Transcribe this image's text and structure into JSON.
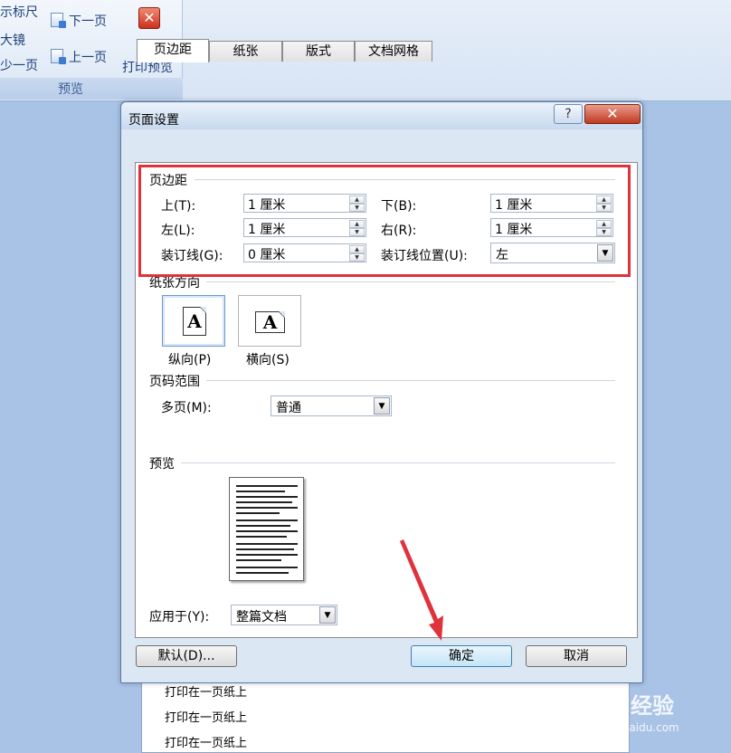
{
  "ribbon": {
    "items": [
      "示标尺",
      "大镜",
      "少一页"
    ],
    "next_page": "下一页",
    "prev_page": "上一页",
    "close_line1": "关闭",
    "close_line2": "打印预览",
    "group_label": "预览"
  },
  "background_page": {
    "lines": [
      "打印在一页纸上",
      "打印在一页纸上",
      "打印在一页纸上"
    ]
  },
  "dialog": {
    "title": "页面设置",
    "help_label": "?",
    "close_label": "✕",
    "tabs": [
      "页边距",
      "纸张",
      "版式",
      "文档网格"
    ],
    "margins": {
      "section_label": "页边距",
      "top_label": "上(T):",
      "top_value": "1 厘米",
      "bottom_label": "下(B):",
      "bottom_value": "1 厘米",
      "left_label": "左(L):",
      "left_value": "1 厘米",
      "right_label": "右(R):",
      "right_value": "1 厘米",
      "gutter_label": "装订线(G):",
      "gutter_value": "0 厘米",
      "gutter_pos_label": "装订线位置(U):",
      "gutter_pos_value": "左"
    },
    "orientation": {
      "section_label": "纸张方向",
      "portrait_label": "纵向(P)",
      "landscape_label": "横向(S)",
      "icon_letter": "A"
    },
    "pages": {
      "section_label": "页码范围",
      "multiple_label": "多页(M):",
      "multiple_value": "普通"
    },
    "preview": {
      "section_label": "预览",
      "apply_label": "应用于(Y):",
      "apply_value": "整篇文档"
    },
    "buttons": {
      "default": "默认(D)...",
      "ok": "确定",
      "cancel": "取消"
    }
  },
  "watermark": {
    "text": "Baidu经验",
    "url": "jingyan.baidu.com"
  },
  "colors": {
    "highlight_red": "#e0323a",
    "background_blue": "#a9c3e6"
  }
}
